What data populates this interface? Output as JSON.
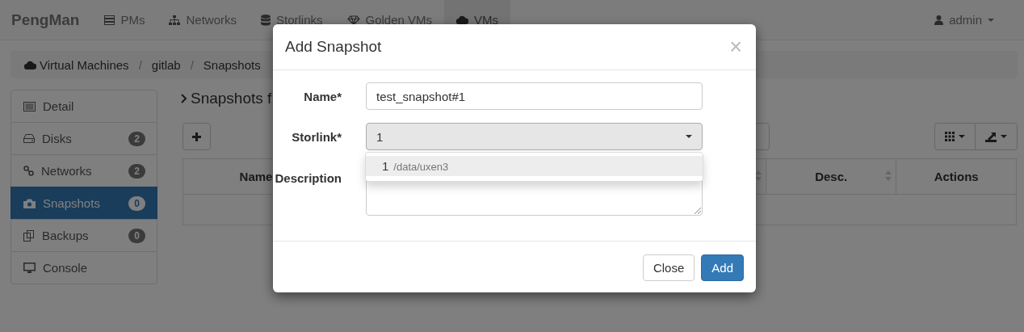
{
  "navbar": {
    "brand": "PengMan",
    "items": [
      {
        "label": "PMs",
        "selected": false
      },
      {
        "label": "Networks",
        "selected": false
      },
      {
        "label": "Storlinks",
        "selected": false
      },
      {
        "label": "Golden VMs",
        "selected": false
      },
      {
        "label": "VMs",
        "selected": true
      }
    ],
    "user": "admin"
  },
  "breadcrumb": [
    {
      "kind": "link",
      "label": "Virtual Machines"
    },
    {
      "kind": "separator",
      "label": "/"
    },
    {
      "kind": "link",
      "label": "gitlab"
    },
    {
      "kind": "separator",
      "label": "/"
    },
    {
      "kind": "link",
      "label": "Snapshots"
    }
  ],
  "sidebar": [
    {
      "label": "Detail",
      "selected": false
    },
    {
      "label": "Disks",
      "badge": "2",
      "selected": false
    },
    {
      "label": "Networks",
      "badge": "2",
      "selected": false
    },
    {
      "label": "Snapshots",
      "badge": "0",
      "selected": true
    },
    {
      "label": "Backups",
      "badge": "0",
      "selected": false
    },
    {
      "label": "Console",
      "selected": false
    }
  ],
  "heading": "Snapshots f",
  "table": {
    "columns": [
      "Name",
      "Desc.",
      "Actions"
    ]
  },
  "modal": {
    "title": "Add Snapshot",
    "close": "×",
    "fields": [
      {
        "kind": "text",
        "label": "Name*",
        "value": "test_snapshot#1"
      },
      {
        "kind": "select",
        "label": "Storlink*",
        "value": "1",
        "open": true,
        "options": [
          {
            "value": "1",
            "detail": "/data/uxen3",
            "selected": true
          }
        ]
      },
      {
        "kind": "textarea",
        "label": "Description"
      }
    ],
    "buttons": [
      {
        "label": "Close",
        "kind": "default"
      },
      {
        "label": "Add",
        "kind": "primary"
      }
    ]
  }
}
